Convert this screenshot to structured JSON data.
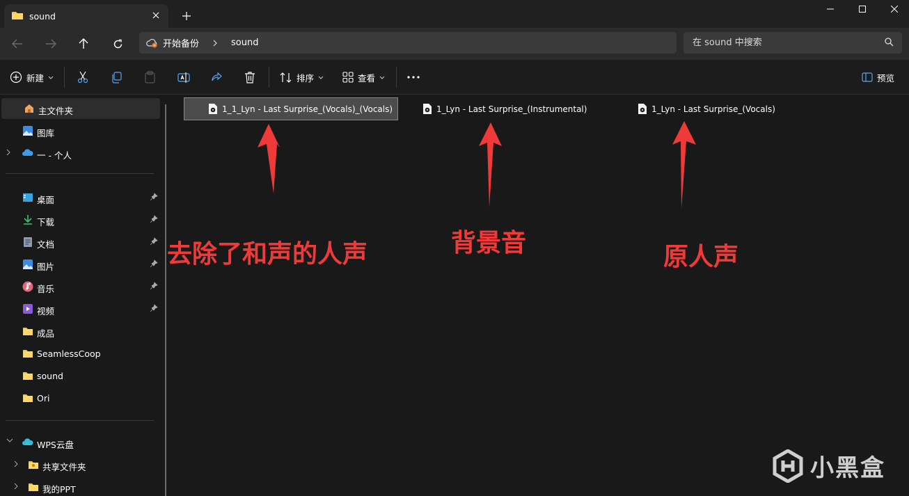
{
  "window": {
    "tab_title": "sound",
    "icons": {
      "folder": "folder-icon",
      "close": "close-icon",
      "new_tab": "plus-icon"
    }
  },
  "nav": {
    "breadcrumb": [
      "开始备份",
      "sound"
    ],
    "search_placeholder": "在 sound 中搜索"
  },
  "toolbar": {
    "new_label": "新建",
    "sort_label": "排序",
    "view_label": "查看",
    "preview_label": "预览"
  },
  "sidebar": {
    "top": [
      {
        "label": "主文件夹",
        "icon": "home-icon"
      },
      {
        "label": "图库",
        "icon": "gallery-icon"
      },
      {
        "label": "一 - 个人",
        "icon": "onedrive-cloud-icon"
      }
    ],
    "quick": [
      {
        "label": "桌面",
        "icon": "desktop-icon",
        "pinned": true
      },
      {
        "label": "下载",
        "icon": "download-icon",
        "pinned": true
      },
      {
        "label": "文档",
        "icon": "document-icon",
        "pinned": true
      },
      {
        "label": "图片",
        "icon": "picture-icon",
        "pinned": true
      },
      {
        "label": "音乐",
        "icon": "music-icon",
        "pinned": true
      },
      {
        "label": "视频",
        "icon": "video-icon",
        "pinned": true
      },
      {
        "label": "成品",
        "icon": "folder-icon",
        "pinned": false
      },
      {
        "label": "SeamlessCoop",
        "icon": "folder-icon",
        "pinned": false
      },
      {
        "label": "sound",
        "icon": "folder-icon",
        "pinned": false
      },
      {
        "label": "Ori",
        "icon": "folder-icon",
        "pinned": false
      }
    ],
    "bottom": [
      {
        "label": "WPS云盘",
        "icon": "wps-cloud-icon"
      },
      {
        "label": "共享文件夹",
        "icon": "shared-folder-icon"
      },
      {
        "label": "我的PPT",
        "icon": "folder-icon"
      }
    ]
  },
  "files": [
    {
      "name": "1_1_Lyn - Last Surprise_(Vocals)_(Vocals)",
      "selected": true
    },
    {
      "name": "1_Lyn - Last Surprise_(Instrumental)",
      "selected": false
    },
    {
      "name": "1_Lyn - Last Surprise_(Vocals)",
      "selected": false
    }
  ],
  "annotations": [
    "去除了和声的人声",
    "背景音",
    "原人声"
  ],
  "watermark": "小黑盒",
  "colors": {
    "annotation": "#f03a3a",
    "folder": "#f6c33e",
    "accent": "#4aa3f0"
  }
}
